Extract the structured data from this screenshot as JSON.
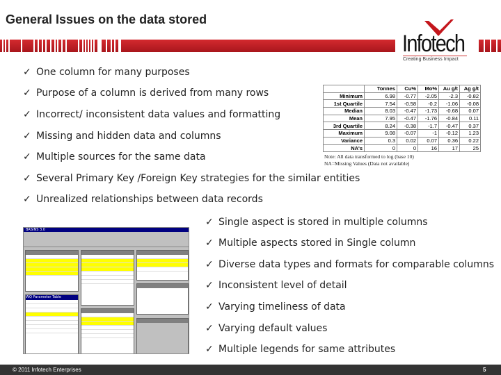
{
  "title": "General Issues on the data stored",
  "logo": {
    "name": "Infotech",
    "tagline": "Creating Business Impact"
  },
  "colors": {
    "accent": "#c4161c",
    "footer": "#333333"
  },
  "bullets_left": [
    "One column for many purposes",
    "Purpose of a column is derived from many rows",
    "Incorrect/ inconsistent data values and formatting",
    "Missing and hidden data and columns",
    "Multiple sources for the same data",
    "Several Primary Key /Foreign Key strategies for the similar entities",
    "Unrealized relationships between data records"
  ],
  "bullets_right": [
    "Single  aspect is stored in multiple columns",
    "Multiple aspects stored in Single column",
    "Diverse data types and formats for comparable columns",
    "Inconsistent level of detail",
    "Varying timeliness of data",
    "Varying default values",
    "Multiple legends for same attributes"
  ],
  "check": "✓",
  "table": {
    "headers": [
      "",
      "Tonnes",
      "Cu%",
      "Mo%",
      "Au g/t",
      "Ag g/t"
    ],
    "rows": [
      [
        "Minimum",
        "6.98",
        "-0.77",
        "-2.05",
        "-2.3",
        "-0.82"
      ],
      [
        "1st Quartile",
        "7.54",
        "-0.58",
        "-0.2",
        "-1.06",
        "-0.08"
      ],
      [
        "Median",
        "8.03",
        "-0.47",
        "-1.73",
        "-0.68",
        "0.07"
      ],
      [
        "Mean",
        "7.95",
        "-0.47",
        "-1.76",
        "-0.84",
        "0.11"
      ],
      [
        "3rd Quartile",
        "8.24",
        "-0.38",
        "-1.7",
        "-0.47",
        "0.37"
      ],
      [
        "Maximum",
        "9.08",
        "-0.07",
        "-1",
        "-0.12",
        "1.23"
      ],
      [
        "Variance",
        "0.3",
        "0.02",
        "0.07",
        "0.36",
        "0.22"
      ],
      [
        "NA's",
        "0",
        "0",
        "16",
        "17",
        "25"
      ]
    ],
    "note1": "Note: All data transformed to log (base 10)",
    "note2": "NA=Missing Values (Data not available)"
  },
  "screenshot": {
    "app_title": "BASINS 3.0",
    "param_table": "WQ Parameter Table"
  },
  "footer": {
    "copyright": "© 2011 Infotech Enterprises",
    "page": "5"
  }
}
